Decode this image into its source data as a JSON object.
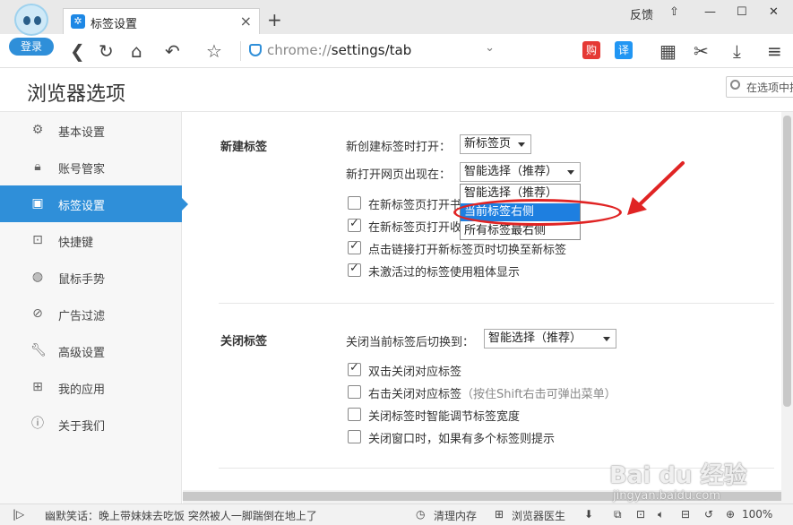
{
  "titlebar": {
    "login_label": "登录",
    "tab_title": "标签设置",
    "tab_close": "×",
    "new_tab": "+",
    "feedback_label": "反馈",
    "minimize": "—",
    "maximize": "☐",
    "close": "✕"
  },
  "toolbar": {
    "url_scheme": "chrome://",
    "url_path": "settings/tab",
    "gou_label": "购",
    "yi_label": "译"
  },
  "page": {
    "title": "浏览器选项",
    "search_placeholder": "在选项中搜索"
  },
  "sidebar": {
    "items": [
      {
        "label": "基本设置",
        "icon": "gear-icon"
      },
      {
        "label": "账号管家",
        "icon": "lock-icon"
      },
      {
        "label": "标签设置",
        "icon": "tab-icon"
      },
      {
        "label": "快捷键",
        "icon": "shortcut-icon"
      },
      {
        "label": "鼠标手势",
        "icon": "mouse-icon"
      },
      {
        "label": "广告过滤",
        "icon": "block-icon"
      },
      {
        "label": "高级设置",
        "icon": "wrench-icon"
      },
      {
        "label": "我的应用",
        "icon": "apps-icon"
      },
      {
        "label": "关于我们",
        "icon": "info-icon"
      }
    ],
    "active_index": 2
  },
  "new_tab_section": {
    "title": "新建标签",
    "open_label": "新创建标签时打开：",
    "open_value": "新标签页",
    "position_label": "新打开网页出现在：",
    "position_value": "智能选择（推荐）",
    "dropdown_options": [
      "智能选择（推荐）",
      "当前标签右侧",
      "所有标签最右侧"
    ],
    "dropdown_highlighted": 1,
    "checkboxes": [
      {
        "label": "在新标签页打开书",
        "checked": false
      },
      {
        "label": "在新标签页打开收",
        "checked": true
      },
      {
        "label": "点击链接打开新标签页时切换至新标签",
        "checked": true
      },
      {
        "label": "未激活过的标签使用粗体显示",
        "checked": true
      }
    ]
  },
  "close_tab_section": {
    "title": "关闭标签",
    "switch_label": "关闭当前标签后切换到：",
    "switch_value": "智能选择（推荐）",
    "checkboxes": [
      {
        "label": "双击关闭对应标签",
        "hint": "",
        "checked": true
      },
      {
        "label": "右击关闭对应标签",
        "hint": "（按住Shift右击可弹出菜单）",
        "checked": false
      },
      {
        "label": "关闭标签时智能调节标签宽度",
        "hint": "",
        "checked": false
      },
      {
        "label": "关闭窗口时，如果有多个标签则提示",
        "hint": "",
        "checked": false
      }
    ]
  },
  "statusbar": {
    "news": "幽默笑话：晚上带妹妹去吃饭 突然被人一脚踹倒在地上了",
    "clean_memory": "清理内存",
    "browser_doctor": "浏览器医生",
    "zoom": "100%"
  },
  "watermark": {
    "brand": "Bai du 经验",
    "domain": "jingyan.baidu.com"
  },
  "colors": {
    "accent": "#2f8fd9",
    "highlight": "#1e7fe0",
    "annotation": "#e02424"
  }
}
